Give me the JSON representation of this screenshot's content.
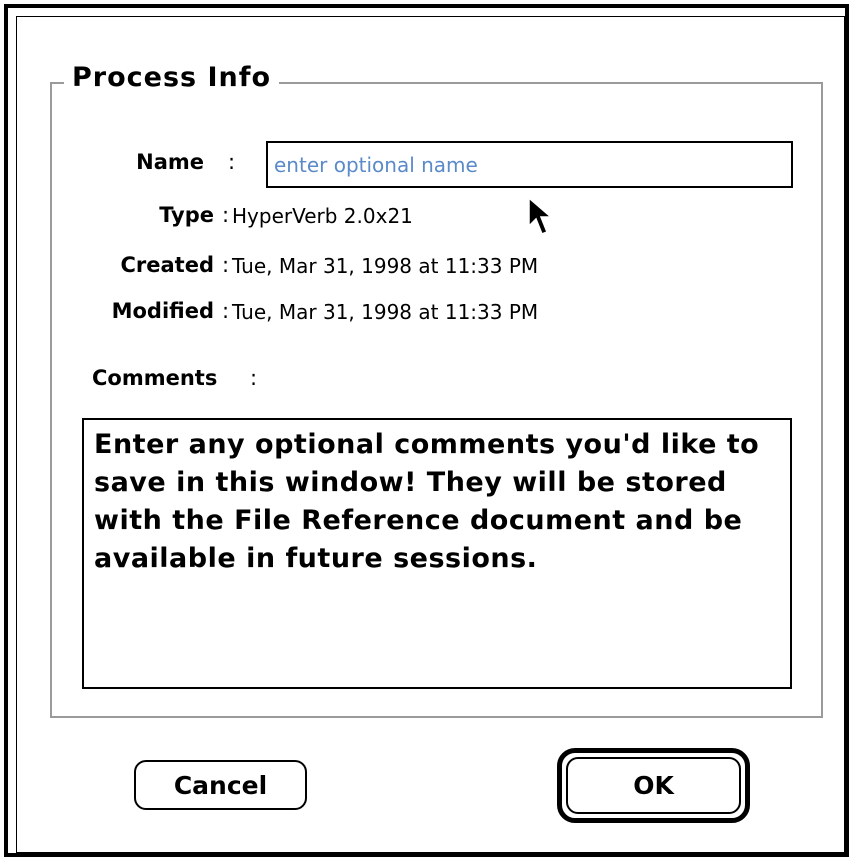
{
  "dialog": {
    "group_title": "Process Info",
    "fields": {
      "name_label": "Name",
      "type_label": "Type",
      "created_label": "Created",
      "modified_label": "Modified",
      "comments_label": "Comments",
      "separator": ":"
    },
    "name_input": {
      "value": "",
      "placeholder": "enter optional name"
    },
    "type_value": "HyperVerb 2.0x21",
    "created_value": "Tue, Mar 31, 1998 at 11:33 PM",
    "modified_value": "Tue, Mar 31, 1998 at 11:33 PM",
    "comments_text": "Enter any optional comments you'd like to save in this window! They will be stored with the File Reference document and be available in future sessions.",
    "buttons": {
      "cancel": "Cancel",
      "ok": "OK"
    },
    "default_button": "ok",
    "placeholder_color": "#5b8ac8",
    "icons": {
      "pointer": "arrow-cursor-icon"
    }
  }
}
